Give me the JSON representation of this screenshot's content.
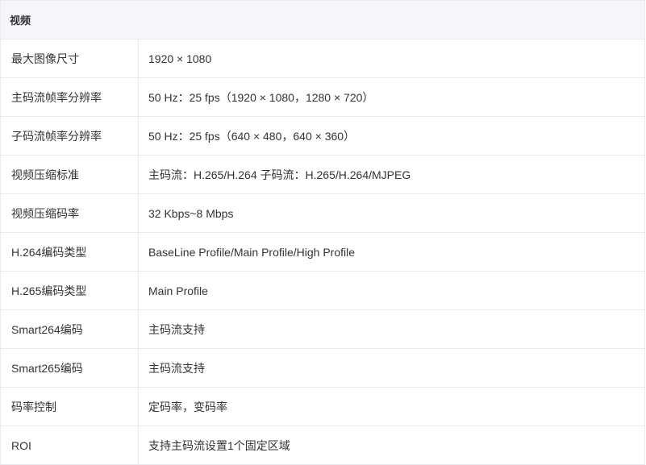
{
  "section": {
    "title": "视频"
  },
  "rows": [
    {
      "label": "最大图像尺寸",
      "value": "1920 × 1080"
    },
    {
      "label": "主码流帧率分辨率",
      "value": "50 Hz：25 fps（1920 × 1080，1280 × 720）"
    },
    {
      "label": "子码流帧率分辨率",
      "value": "50 Hz：25 fps（640 × 480，640 × 360）"
    },
    {
      "label": "视频压缩标准",
      "value": "主码流：H.265/H.264 子码流：H.265/H.264/MJPEG"
    },
    {
      "label": "视频压缩码率",
      "value": "32 Kbps~8 Mbps"
    },
    {
      "label": "H.264编码类型",
      "value": "BaseLine Profile/Main Profile/High Profile"
    },
    {
      "label": "H.265编码类型",
      "value": "Main Profile"
    },
    {
      "label": "Smart264编码",
      "value": "主码流支持"
    },
    {
      "label": "Smart265编码",
      "value": "主码流支持"
    },
    {
      "label": "码率控制",
      "value": "定码率，变码率"
    },
    {
      "label": "ROI",
      "value": "支持主码流设置1个固定区域"
    }
  ]
}
